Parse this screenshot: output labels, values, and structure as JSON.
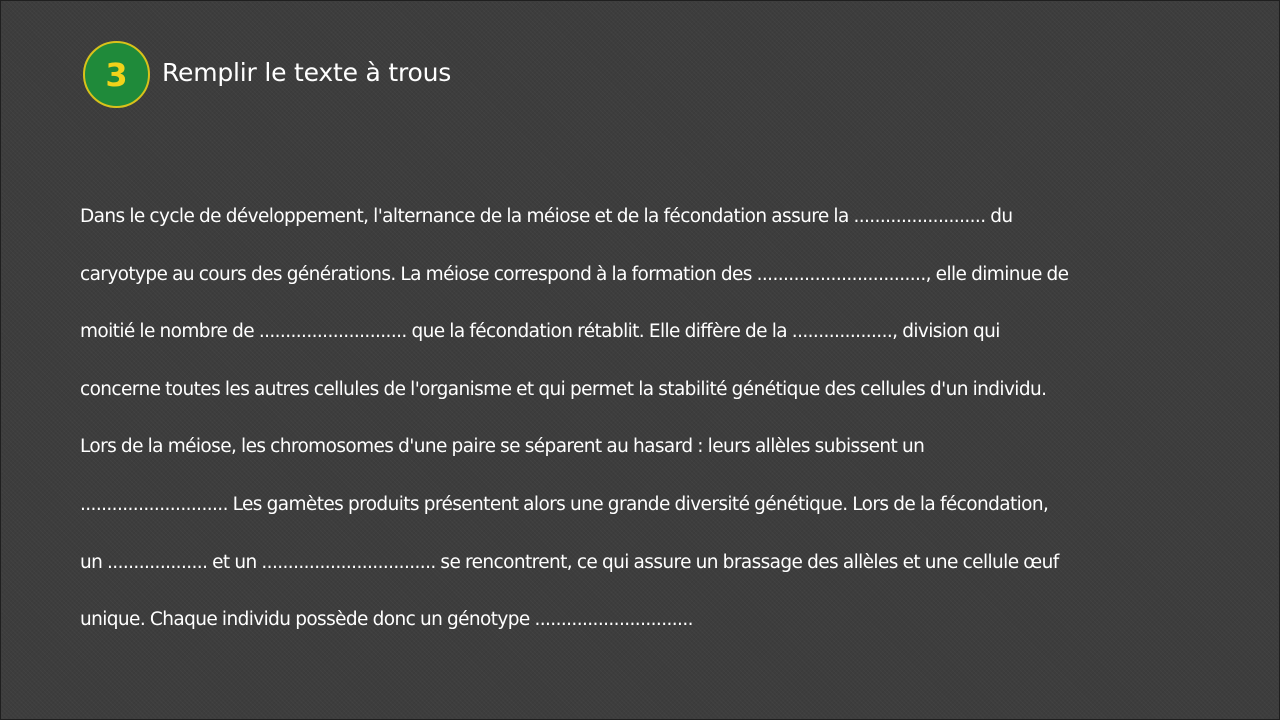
{
  "slide": {
    "number": "3",
    "title": "Remplir le texte à trous"
  },
  "text": {
    "lines": [
      "Dans le cycle de développement, l'alternance de la méiose et de la fécondation assure la ......................... du",
      "caryotype au cours des générations. La méiose correspond à la formation des ................................, elle diminue de",
      "moitié le nombre de ............................ que la fécondation rétablit. Elle diffère de la ..................., division qui",
      "concerne toutes les autres cellules de l'organisme et qui permet la stabilité génétique des cellules d'un individu.",
      "Lors de la méiose, les chromosomes d'une paire se séparent au hasard : leurs allèles subissent un",
      "............................ Les gamètes produits présentent alors une grande diversité génétique. Lors de la fécondation,",
      "un ................... et un ................................. se rencontrent, ce qui assure un brassage des allèles et une cellule œuf",
      "unique. Chaque individu possède donc un génotype .............................."
    ]
  },
  "colors": {
    "background": "#3d3d3d",
    "badge_fill": "#1f8a3a",
    "badge_border": "#d8c21a",
    "badge_text": "#f2d21a",
    "text": "#ffffff"
  }
}
